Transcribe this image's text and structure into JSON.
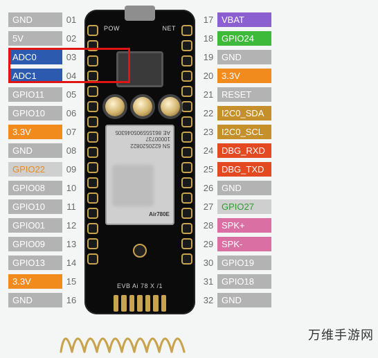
{
  "board": {
    "top_left_label": "POW",
    "top_right_label": "NET",
    "module_name": "Air780E",
    "module_sn_line1": "SN 6220520822 10000737",
    "module_sn_line2": "AE 861555905046305",
    "silk_text": "EVB Ai 78  X  /1"
  },
  "left_pins": [
    {
      "num": "01",
      "label": "GND",
      "cls": "c-gray"
    },
    {
      "num": "02",
      "label": "5V",
      "cls": "c-gray"
    },
    {
      "num": "03",
      "label": "ADC0",
      "cls": "c-blue"
    },
    {
      "num": "04",
      "label": "ADC1",
      "cls": "c-blue"
    },
    {
      "num": "05",
      "label": "GPIO11",
      "cls": "c-gray"
    },
    {
      "num": "06",
      "label": "GPIO10",
      "cls": "c-gray"
    },
    {
      "num": "07",
      "label": "3.3V",
      "cls": "c-orange"
    },
    {
      "num": "08",
      "label": "GND",
      "cls": "c-gray"
    },
    {
      "num": "09",
      "label": "GPIO22",
      "cls": "t-orange"
    },
    {
      "num": "10",
      "label": "GPIO08",
      "cls": "c-gray"
    },
    {
      "num": "11",
      "label": "GPIO10",
      "cls": "c-gray"
    },
    {
      "num": "12",
      "label": "GPIO01",
      "cls": "c-gray"
    },
    {
      "num": "13",
      "label": "GPIO09",
      "cls": "c-gray"
    },
    {
      "num": "14",
      "label": "GPIO13",
      "cls": "c-gray"
    },
    {
      "num": "15",
      "label": "3.3V",
      "cls": "c-orange"
    },
    {
      "num": "16",
      "label": "GND",
      "cls": "c-gray"
    }
  ],
  "right_pins": [
    {
      "num": "17",
      "label": "VBAT",
      "cls": "c-purple"
    },
    {
      "num": "18",
      "label": "GPIO24",
      "cls": "c-green"
    },
    {
      "num": "19",
      "label": "GND",
      "cls": "c-gray"
    },
    {
      "num": "20",
      "label": "3.3V",
      "cls": "c-orange"
    },
    {
      "num": "21",
      "label": "RESET",
      "cls": "c-gray"
    },
    {
      "num": "22",
      "label": "I2C0_SDA",
      "cls": "c-brown"
    },
    {
      "num": "23",
      "label": "I2C0_SCL",
      "cls": "c-brown"
    },
    {
      "num": "24",
      "label": "DBG_RXD",
      "cls": "c-red"
    },
    {
      "num": "25",
      "label": "DBG_TXD",
      "cls": "c-red"
    },
    {
      "num": "26",
      "label": "GND",
      "cls": "c-gray"
    },
    {
      "num": "27",
      "label": "GPIO27",
      "cls": "t-green"
    },
    {
      "num": "28",
      "label": "SPK+",
      "cls": "c-pink"
    },
    {
      "num": "29",
      "label": "SPK-",
      "cls": "c-pink"
    },
    {
      "num": "30",
      "label": "GPIO19",
      "cls": "c-gray"
    },
    {
      "num": "31",
      "label": "GPIO18",
      "cls": "c-gray"
    },
    {
      "num": "32",
      "label": "GND",
      "cls": "c-gray"
    }
  ],
  "watermark": "万维手游网"
}
